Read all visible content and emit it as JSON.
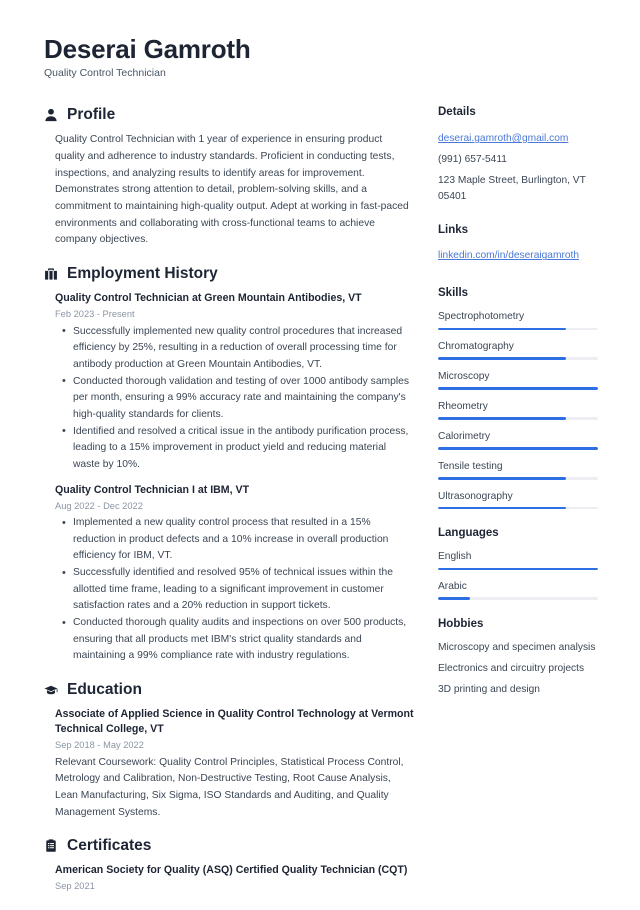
{
  "header": {
    "name": "Deserai Gamroth",
    "title": "Quality Control Technician"
  },
  "colors": {
    "accent": "#2f6fe4",
    "link": "#4a78d6",
    "heading": "#1d2433",
    "body": "#3b4654",
    "muted": "#8b95a3",
    "track": "#eceef1"
  },
  "sections": {
    "profile": {
      "icon": "user-icon",
      "title": "Profile",
      "text": "Quality Control Technician with 1 year of experience in ensuring product quality and adherence to industry standards. Proficient in conducting tests, inspections, and analyzing results to identify areas for improvement. Demonstrates strong attention to detail, problem-solving skills, and a commitment to maintaining high-quality output. Adept at working in fast-paced environments and collaborating with cross-functional teams to achieve company objectives."
    },
    "employment": {
      "icon": "briefcase-icon",
      "title": "Employment History",
      "entries": [
        {
          "title": "Quality Control Technician at Green Mountain Antibodies, VT",
          "date": "Feb 2023 - Present",
          "bullets": [
            "Successfully implemented new quality control procedures that increased efficiency by 25%, resulting in a reduction of overall processing time for antibody production at Green Mountain Antibodies, VT.",
            "Conducted thorough validation and testing of over 1000 antibody samples per month, ensuring a 99% accuracy rate and maintaining the company's high-quality standards for clients.",
            "Identified and resolved a critical issue in the antibody purification process, leading to a 15% improvement in product yield and reducing material waste by 10%."
          ]
        },
        {
          "title": "Quality Control Technician I at IBM, VT",
          "date": "Aug 2022 - Dec 2022",
          "bullets": [
            "Implemented a new quality control process that resulted in a 15% reduction in product defects and a 10% increase in overall production efficiency for IBM, VT.",
            "Successfully identified and resolved 95% of technical issues within the allotted time frame, leading to a significant improvement in customer satisfaction rates and a 20% reduction in support tickets.",
            "Conducted thorough quality audits and inspections on over 500 products, ensuring that all products met IBM's strict quality standards and maintaining a 99% compliance rate with industry regulations."
          ]
        }
      ]
    },
    "education": {
      "icon": "graduation-cap-icon",
      "title": "Education",
      "entries": [
        {
          "title": "Associate of Applied Science in Quality Control Technology at Vermont Technical College, VT",
          "date": "Sep 2018 - May 2022",
          "description": "Relevant Coursework: Quality Control Principles, Statistical Process Control, Metrology and Calibration, Non-Destructive Testing, Root Cause Analysis, Lean Manufacturing, Six Sigma, ISO Standards and Auditing, and Quality Management Systems."
        }
      ]
    },
    "certificates": {
      "icon": "clipboard-icon",
      "title": "Certificates",
      "entries": [
        {
          "title": "American Society for Quality (ASQ) Certified Quality Technician (CQT)",
          "date": "Sep 2021"
        }
      ]
    }
  },
  "sidebar": {
    "details": {
      "title": "Details",
      "email": "deserai.gamroth@gmail.com",
      "phone": "(991) 657-5411",
      "address": "123 Maple Street, Burlington, VT 05401"
    },
    "links": {
      "title": "Links",
      "items": [
        {
          "label": "linkedin.com/in/deseraigamroth"
        }
      ]
    },
    "skills": {
      "title": "Skills",
      "items": [
        {
          "label": "Spectrophotometry",
          "level": 80
        },
        {
          "label": "Chromatography",
          "level": 80
        },
        {
          "label": "Microscopy",
          "level": 100
        },
        {
          "label": "Rheometry",
          "level": 80
        },
        {
          "label": "Calorimetry",
          "level": 100
        },
        {
          "label": "Tensile testing",
          "level": 80
        },
        {
          "label": "Ultrasonography",
          "level": 80
        }
      ]
    },
    "languages": {
      "title": "Languages",
      "items": [
        {
          "label": "English",
          "level": 100
        },
        {
          "label": "Arabic",
          "level": 20
        }
      ]
    },
    "hobbies": {
      "title": "Hobbies",
      "items": [
        "Microscopy and specimen analysis",
        "Electronics and circuitry projects",
        "3D printing and design"
      ]
    }
  }
}
